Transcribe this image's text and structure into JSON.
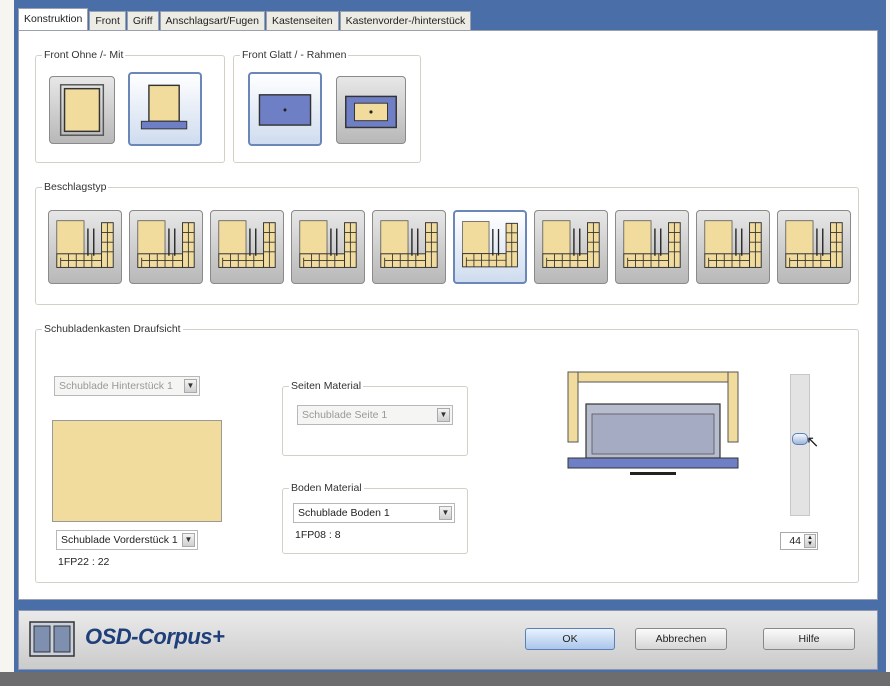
{
  "tabs": [
    {
      "label": "Konstruktion",
      "active": true
    },
    {
      "label": "Front"
    },
    {
      "label": "Griff"
    },
    {
      "label": "Anschlagsart/Fugen"
    },
    {
      "label": "Kastenseiten"
    },
    {
      "label": "Kastenvorder-/hinterstück"
    }
  ],
  "groups": {
    "front_ohne_mit": "Front Ohne /- Mit",
    "front_glatt_rahmen": "Front Glatt / - Rahmen",
    "beschlagstyp": "Beschlagstyp",
    "draufsicht": "Schubladenkasten Draufsicht",
    "seiten_material": "Seiten Material",
    "boden_material": "Boden Material"
  },
  "draufsicht": {
    "hinterstueck_combo": "Schublade Hinterstück 1",
    "vorderstueck_combo": "Schublade Vorderstück 1",
    "vorderstueck_code": "1FP22 : 22",
    "seite_combo": "Schublade Seite 1",
    "boden_combo": "Boden Material",
    "boden_value": "Schublade Boden 1",
    "boden_code": "1FP08 : 8",
    "slider_value": "44"
  },
  "beschlag_selected_index": 5,
  "buttons": {
    "ok": "OK",
    "cancel": "Abbrechen",
    "help": "Hilfe"
  },
  "brand": "OSD-Corpus+",
  "colors": {
    "accent": "#4a6fa8",
    "wood": "#f1dc9e",
    "box": "#6f7fc6"
  }
}
